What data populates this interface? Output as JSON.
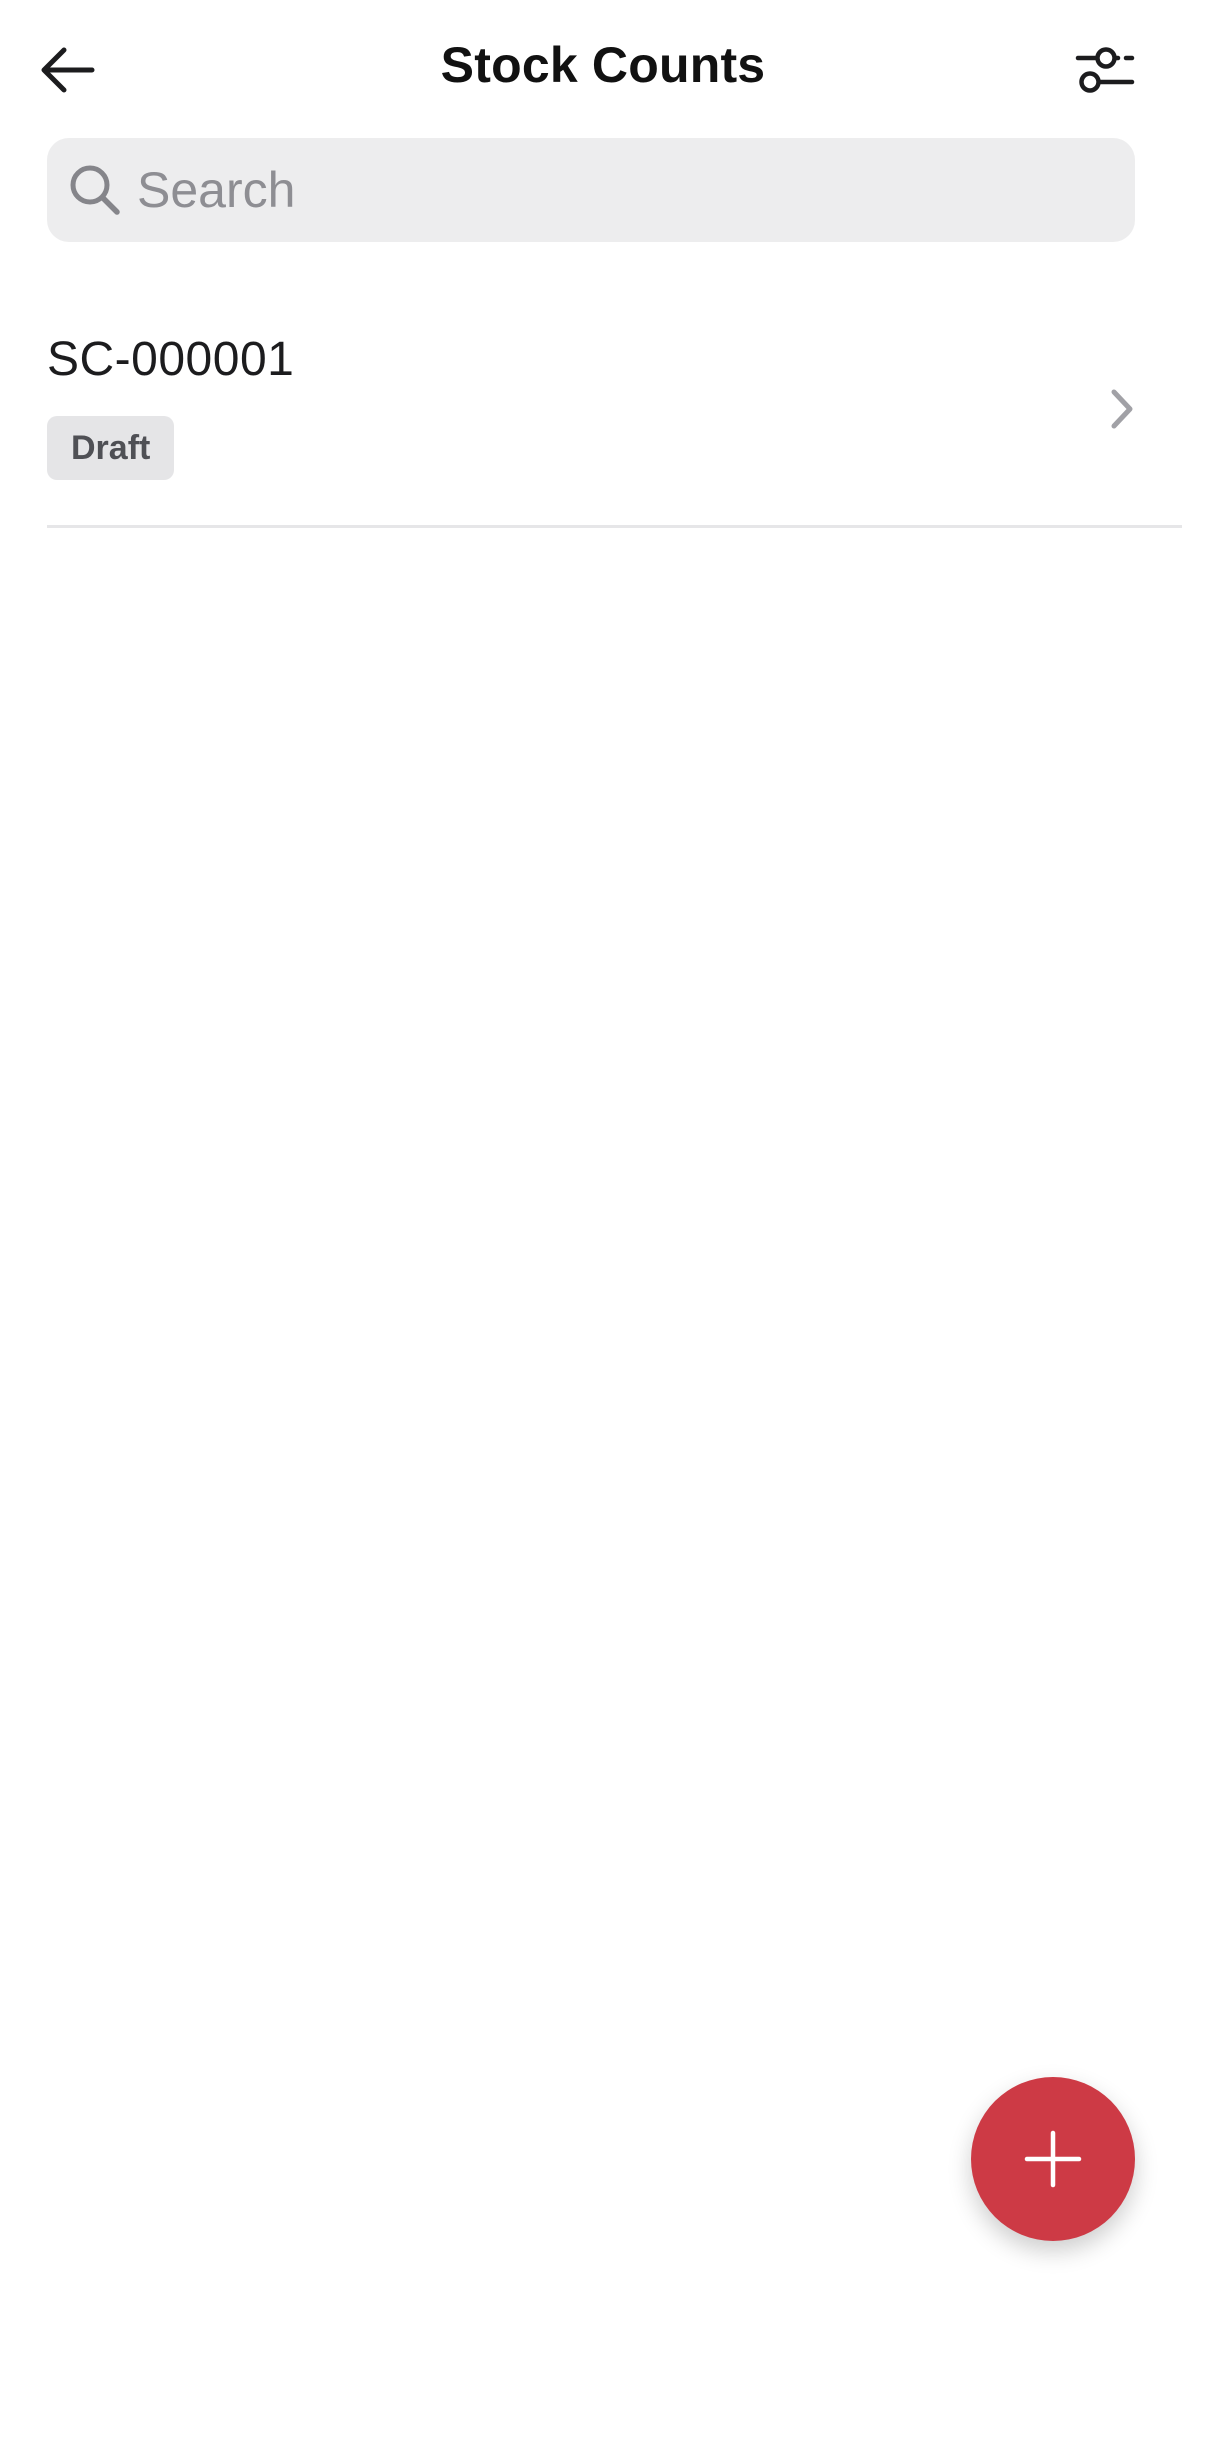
{
  "header": {
    "title": "Stock Counts",
    "back_icon": "arrow-left-icon",
    "filter_icon": "sliders-icon"
  },
  "search": {
    "placeholder": "Search",
    "value": "",
    "icon": "search-icon"
  },
  "list": {
    "items": [
      {
        "title": "SC-000001",
        "status": "Draft",
        "chevron_icon": "chevron-right-icon"
      }
    ]
  },
  "fab": {
    "icon": "plus-icon",
    "color": "#cd3a45"
  },
  "colors": {
    "search_bg": "#ededee",
    "badge_bg": "#e5e5e7",
    "badge_text": "#4f5055",
    "divider": "#e6e6e8",
    "accent": "#cd3a45"
  }
}
